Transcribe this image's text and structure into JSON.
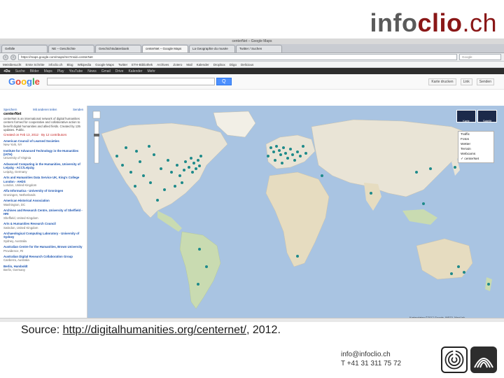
{
  "brand": {
    "part1": "info",
    "part2": "clio",
    "part3": ".ch"
  },
  "browser": {
    "window_title": "centerNet – Google Maps",
    "tabs": [
      "Gefälle",
      "NE – Geschichte",
      "Geschichtsdatenbank",
      "centerNet – Google Maps",
      "La Geographie du musée",
      "Twitter / Suchen"
    ],
    "url": "https://maps.google.com/maps/ms?msid=centerNet",
    "search_placeholder": "Google",
    "bookmarks": [
      "Meistbesucht",
      "Erste Schritte",
      "infoclio.ch",
      "Blog",
      "Wikipedia",
      "Google Maps",
      "Twitter",
      "ETH-Bibliothek",
      "Archives",
      "Zotero",
      "Mail",
      "Kalender",
      "Dropbox",
      "Diigo",
      "Delicious"
    ]
  },
  "google_bar": {
    "items": [
      "+Du",
      "Suche",
      "Bilder",
      "Maps",
      "Play",
      "YouTube",
      "News",
      "Gmail",
      "Drive",
      "Kalender",
      "Mehr"
    ]
  },
  "maps_header": {
    "logo": "Google",
    "search_button": "Q",
    "right_items": [
      "Karte drucken",
      "Link",
      "Senden"
    ]
  },
  "panel": {
    "links": [
      "Speichern",
      "Mit anderen teilen",
      "Senden"
    ],
    "title": "centerNet",
    "description": "centerNet is an international network of digital humanities centers formed for cooperative and collaborative action to benefit digital humanities and allied fields. Created by 135 updates. Public.",
    "meta": "Created on Feb 13, 2012 · By 12 contributors",
    "entries": [
      {
        "title": "American Council of Learned Societies",
        "meta": "New York, NY"
      },
      {
        "title": "Institute for Advanced Technology in the Humanities (IATH)",
        "meta": "University of Virginia"
      },
      {
        "title": "Advanced Computing in the Humanities, University of Leipzig - ACC/Leipzig",
        "meta": "Leipzig, Germany"
      },
      {
        "title": "Arts and Humanities Data Service UK, King's College London - AHDS",
        "meta": "London, United Kingdom"
      },
      {
        "title": "Alfa Informatica - University of Groningen",
        "meta": "Groningen, Netherlands"
      },
      {
        "title": "American Historical Association",
        "meta": "Washington, DC"
      },
      {
        "title": "Archives and Research Centre, University of Sheffield - HRI",
        "meta": "Sheffield, United Kingdom"
      },
      {
        "title": "Arts & Humanities Research Council",
        "meta": "Swindon, United Kingdom"
      },
      {
        "title": "Archaeological Computing Laboratory - University of Sydney",
        "meta": "Sydney, Australia"
      },
      {
        "title": "Australian Centre for the Humanities, Brown University",
        "meta": "Providence, RI"
      },
      {
        "title": "Australian Digital Research Collaboration Group",
        "meta": "Canberra, Australia"
      },
      {
        "title": "Berlin, Humboldt",
        "meta": "Berlin, Germany"
      }
    ]
  },
  "map": {
    "type_buttons": [
      "Karte",
      "Satellit"
    ],
    "layers": [
      "Traffic",
      "Fotos",
      "Wetter",
      "Terrain",
      "Webcams",
      "centerNet"
    ],
    "attribution": "Kartendaten ©2012 Google, INEGI, MapLink"
  },
  "footer": {
    "source_prefix": "Source: ",
    "source_link": "http://digitalhumanities.org/centernet/",
    "source_suffix": ", 2012.",
    "email": "info@infoclio.ch",
    "phone": "T +41 31 311 75 72"
  },
  "colors": {
    "ocean": "#a9c4e2",
    "land": "#e9e4d6",
    "forest": "#c9dbb1",
    "marker": "#1e8a8a",
    "brand_red": "#8a1717",
    "brand_gray": "#5a5a5a"
  }
}
